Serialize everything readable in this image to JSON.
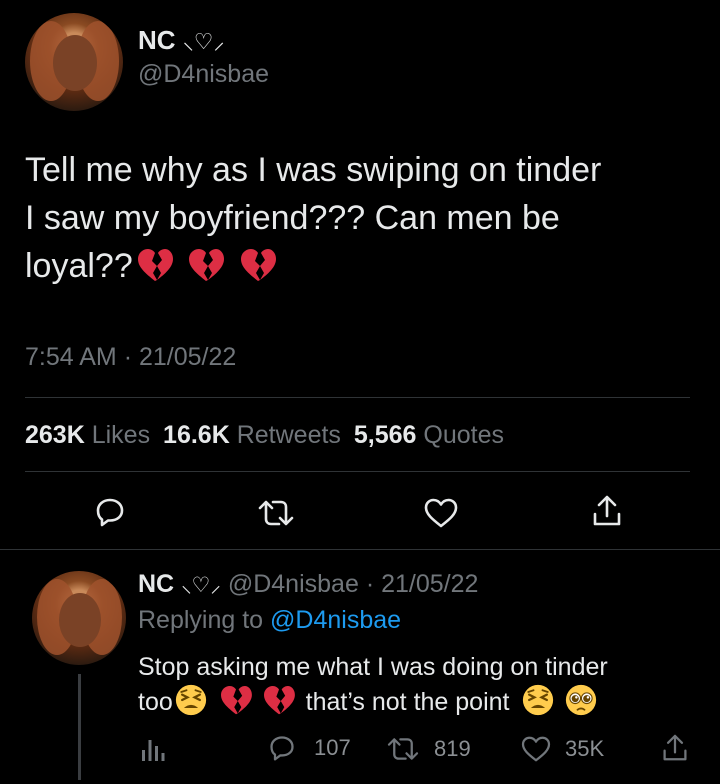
{
  "tweet": {
    "display_name": "NC",
    "name_decoration": "⸜♡⸝",
    "handle": "@D4nisbae",
    "text_lines": [
      "Tell me why as I was swiping on tinder",
      "I saw my boyfriend??? Can men be",
      "loyal??"
    ],
    "text_emojis": [
      "broken-heart",
      "broken-heart",
      "broken-heart"
    ],
    "time": "7:54 AM",
    "separator": "·",
    "date": "21/05/22",
    "stats": {
      "likes_count": "263K",
      "likes_label": "Likes",
      "retweets_count": "16.6K",
      "retweets_label": "Retweets",
      "quotes_count": "5,566",
      "quotes_label": "Quotes"
    },
    "actions": [
      "reply-icon",
      "retweet-icon",
      "like-icon",
      "share-icon"
    ]
  },
  "reply": {
    "display_name": "NC",
    "name_decoration": "⸜♡⸝",
    "handle": "@D4nisbae",
    "separator": "·",
    "date": "21/05/22",
    "replying_prefix": "Replying to",
    "replying_to": "@D4nisbae",
    "line1": "Stop asking me what I was doing on tinder",
    "line2_start": "too",
    "line2_mid": "that’s not the point",
    "emojis": [
      "tired-face",
      "broken-heart",
      "broken-heart",
      "tired-face",
      "pleading-face"
    ],
    "counts": {
      "replies": "107",
      "retweets": "819",
      "likes": "35K"
    }
  },
  "colors": {
    "background": "#000000",
    "text": "#e7e9ea",
    "muted": "#71767b",
    "link": "#1d9bf0",
    "divider": "#2f3336",
    "broken_heart": "#e0245e",
    "emoji_face": "#ffcc4d"
  }
}
